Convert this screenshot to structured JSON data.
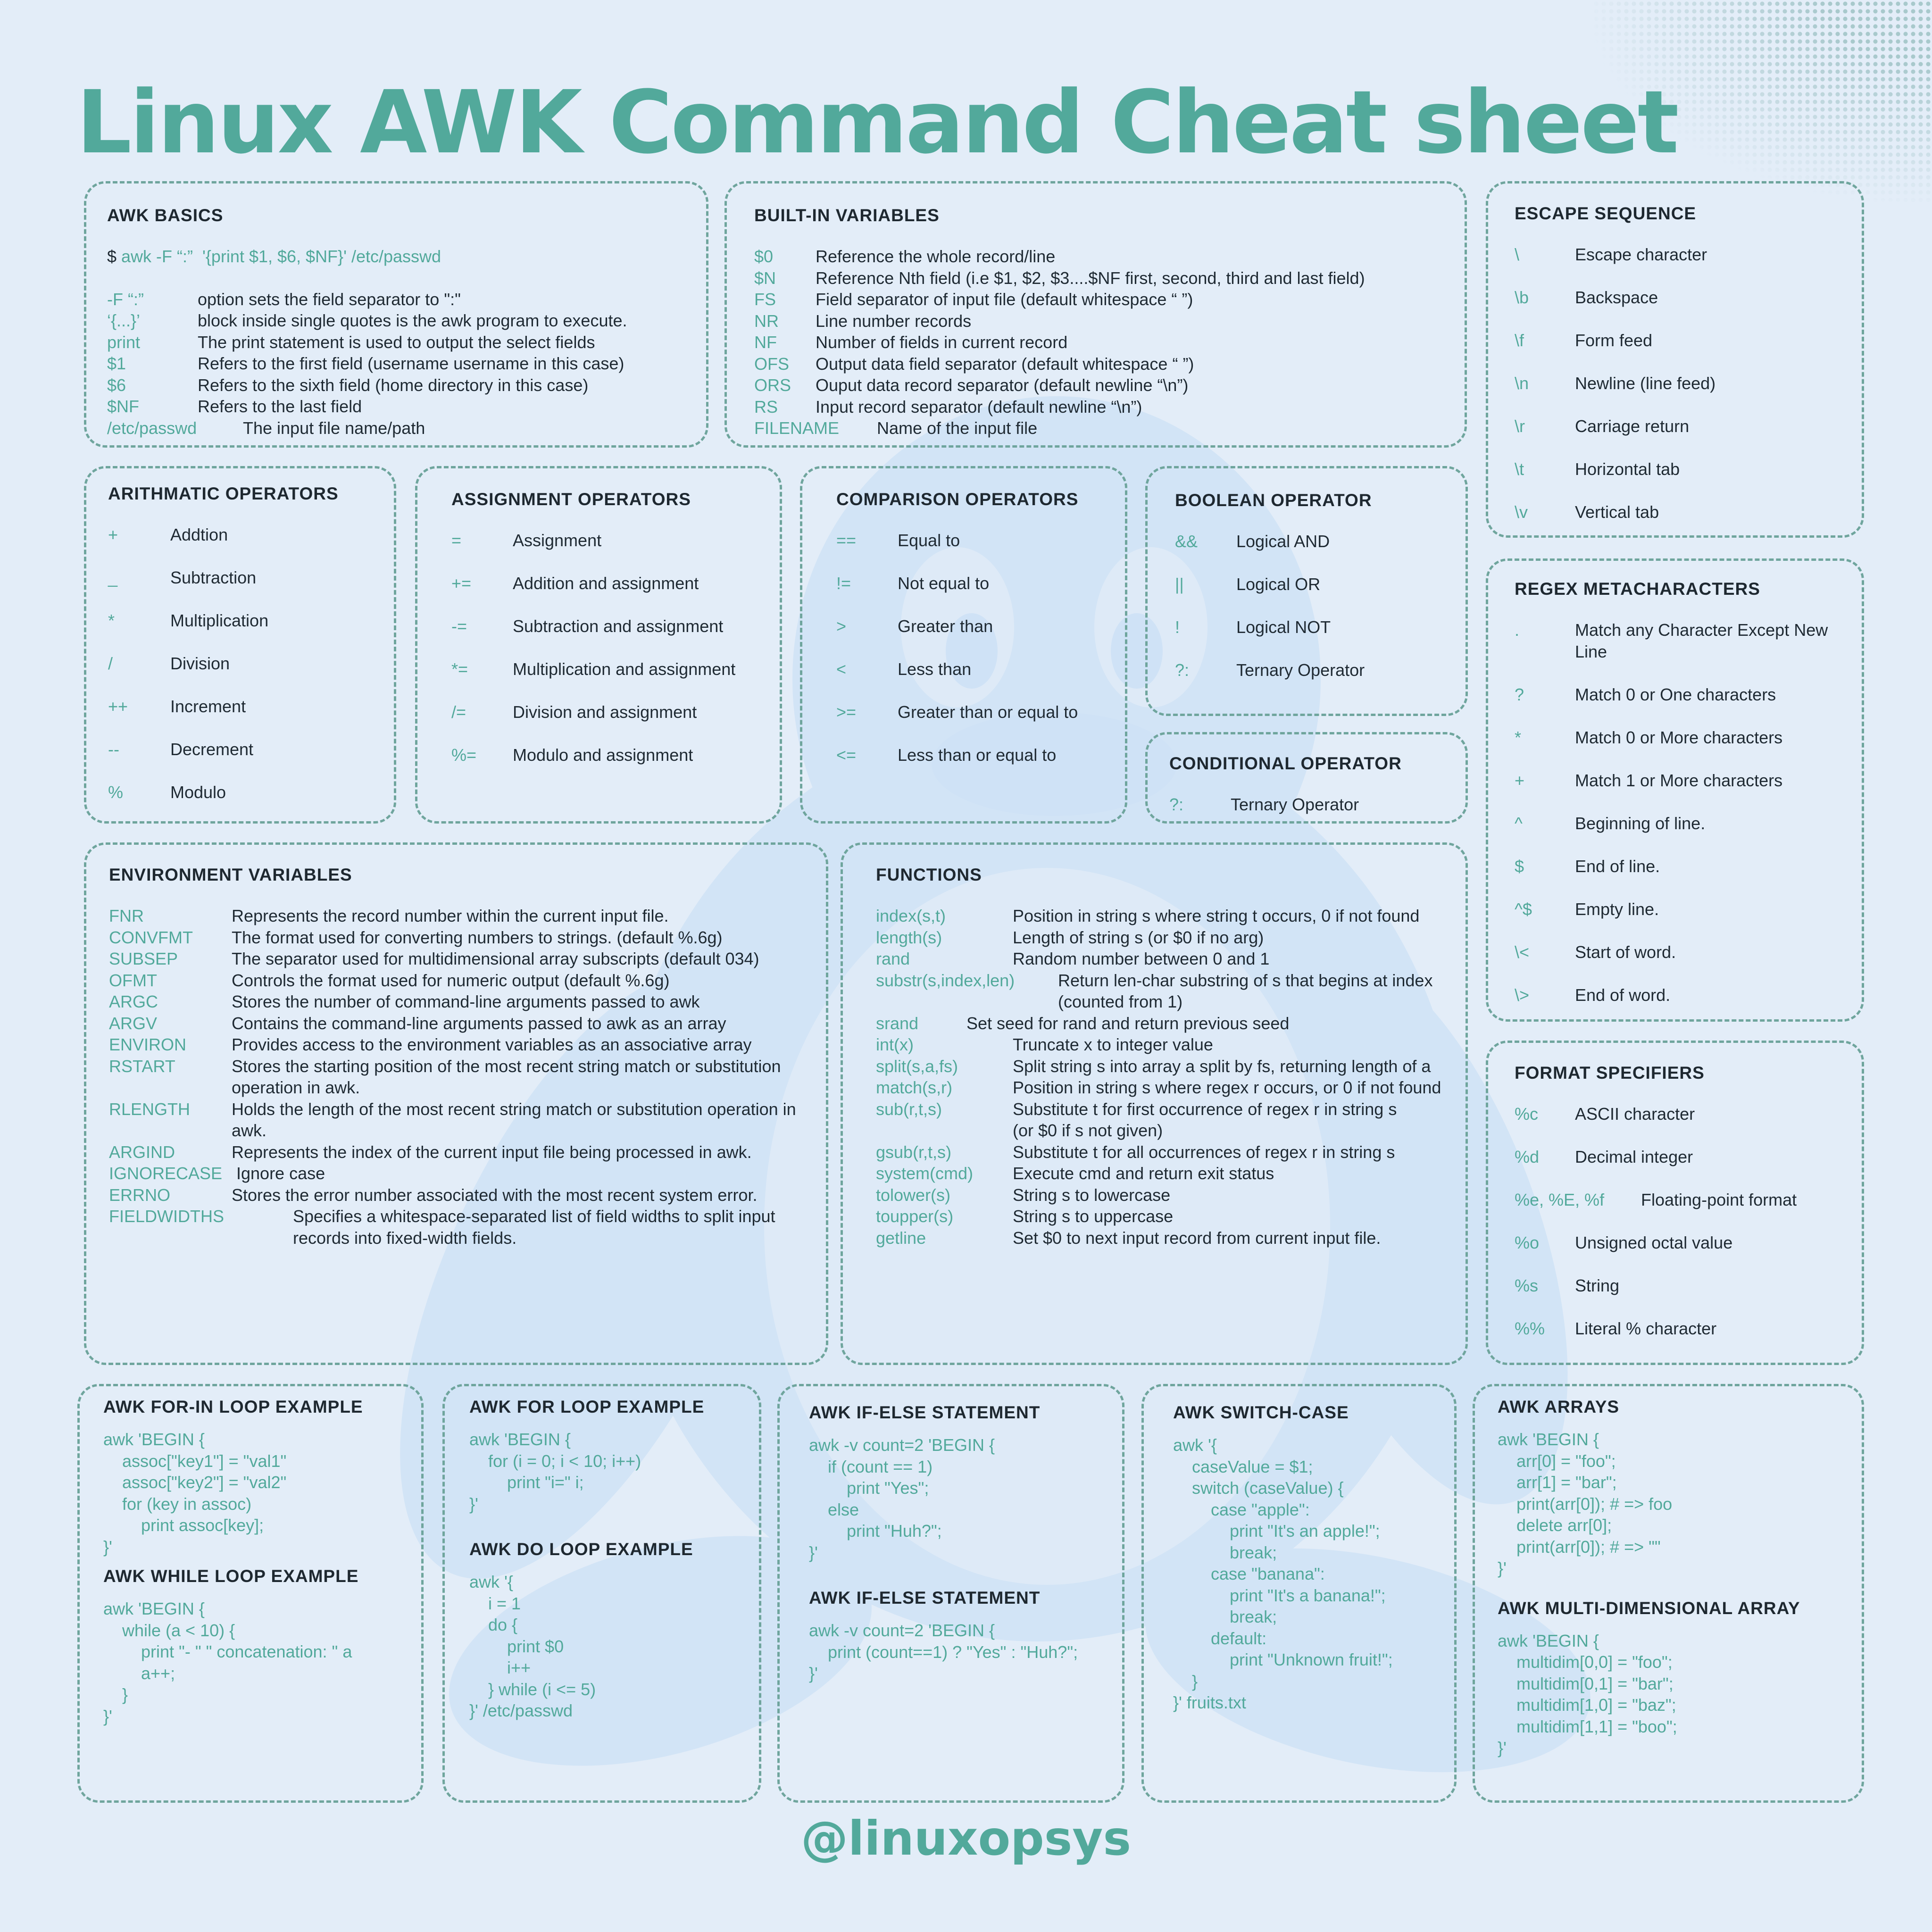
{
  "title": "Linux AWK Command Cheat sheet",
  "handle": "@linuxopsys",
  "colors": {
    "background": "#e3edf8",
    "accent": "#52a99b",
    "border": "#6fa59d",
    "text": "#1e2830",
    "watermark": "#cfe2f6"
  },
  "awk_basics": {
    "heading": "AWK BASICS",
    "prompt": "$",
    "command": " awk -F “:”  '{print $1, $6, $NF}' /etc/passwd",
    "rows": [
      {
        "k": "-F “:”",
        "d": "option sets the field separator to \":\""
      },
      {
        "k": "‘{...}’",
        "d": "block inside single quotes is the awk program to execute."
      },
      {
        "k": "print",
        "d": "The print statement is used to output the select fields"
      },
      {
        "k": "$1",
        "d": "Refers to the first field (username username in this case)"
      },
      {
        "k": "$6",
        "d": "Refers to the sixth field (home directory in this case)"
      },
      {
        "k": "$NF",
        "d": "Refers to the last field"
      },
      {
        "k": "/etc/passwd",
        "d": "The input file name/path"
      }
    ]
  },
  "builtin": {
    "heading": "BUILT-IN VARIABLES",
    "rows": [
      {
        "k": "$0",
        "d": "Reference the whole record/line"
      },
      {
        "k": "$N",
        "d": "Reference Nth field (i.e $1, $2, $3....$NF first, second, third and last field)"
      },
      {
        "k": "FS",
        "d": "Field separator of input file (default whitespace “ ”)"
      },
      {
        "k": "NR",
        "d": "Line number records"
      },
      {
        "k": "NF",
        "d": "Number of fields in current record"
      },
      {
        "k": "OFS",
        "d": "Output data field separator (default whitespace “ ”)"
      },
      {
        "k": "ORS",
        "d": "Ouput data record separator (default newline “\\n”)"
      },
      {
        "k": "RS",
        "d": "Input record separator (default newline “\\n”)"
      },
      {
        "k": "FILENAME",
        "d": "Name of the input file"
      }
    ]
  },
  "escape": {
    "heading": "ESCAPE SEQUENCE",
    "rows": [
      {
        "k": "\\",
        "d": "Escape character"
      },
      {
        "k": "\\b",
        "d": "Backspace"
      },
      {
        "k": "\\f",
        "d": "Form feed"
      },
      {
        "k": "\\n",
        "d": "Newline (line feed)"
      },
      {
        "k": "\\r",
        "d": "Carriage return"
      },
      {
        "k": "\\t",
        "d": "Horizontal tab"
      },
      {
        "k": "\\v",
        "d": "Vertical tab"
      }
    ]
  },
  "arith": {
    "heading": "ARITHMATIC OPERATORS",
    "rows": [
      {
        "k": "+",
        "d": "Addtion"
      },
      {
        "k": "_",
        "d": "Subtraction"
      },
      {
        "k": "*",
        "d": "Multiplication"
      },
      {
        "k": "/",
        "d": "Division"
      },
      {
        "k": "++",
        "d": "Increment"
      },
      {
        "k": "--",
        "d": "Decrement"
      },
      {
        "k": "%",
        "d": "Modulo"
      }
    ]
  },
  "assign": {
    "heading": "ASSIGNMENT OPERATORS",
    "rows": [
      {
        "k": "=",
        "d": "Assignment"
      },
      {
        "k": "+=",
        "d": "Addition and assignment"
      },
      {
        "k": "-=",
        "d": "Subtraction and assignment"
      },
      {
        "k": "*=",
        "d": "Multiplication and assignment"
      },
      {
        "k": "/=",
        "d": "Division and assignment"
      },
      {
        "k": "%=",
        "d": "Modulo and assignment"
      }
    ]
  },
  "compare": {
    "heading": "COMPARISON OPERATORS",
    "rows": [
      {
        "k": "==",
        "d": "Equal to"
      },
      {
        "k": "!=",
        "d": "Not equal to"
      },
      {
        "k": ">",
        "d": "Greater than"
      },
      {
        "k": "<",
        "d": "Less than"
      },
      {
        "k": ">=",
        "d": "Greater than or equal to"
      },
      {
        "k": "<=",
        "d": "Less than or equal to"
      }
    ]
  },
  "boolean": {
    "heading": "BOOLEAN  OPERATOR",
    "rows": [
      {
        "k": "&&",
        "d": "Logical AND"
      },
      {
        "k": "||",
        "d": "Logical OR"
      },
      {
        "k": "!",
        "d": "Logical NOT"
      },
      {
        "k": "?:",
        "d": "Ternary Operator"
      }
    ]
  },
  "conditional": {
    "heading": "CONDITIONAL OPERATOR",
    "rows": [
      {
        "k": "?:",
        "d": "Ternary Operator"
      }
    ]
  },
  "regex": {
    "heading": "REGEX METACHARACTERS",
    "rows": [
      {
        "k": ".",
        "d": "Match any Character Except New Line"
      },
      {
        "k": "?",
        "d": "Match 0 or One characters"
      },
      {
        "k": "*",
        "d": "Match 0 or More characters"
      },
      {
        "k": "+",
        "d": "Match 1 or More characters"
      },
      {
        "k": "^",
        "d": "Beginning of line."
      },
      {
        "k": "$",
        "d": "End of line."
      },
      {
        "k": "^$",
        "d": "Empty line."
      },
      {
        "k": "\\<",
        "d": "Start of word."
      },
      {
        "k": "\\>",
        "d": "End of word."
      }
    ]
  },
  "env": {
    "heading": "ENVIRONMENT VARIABLES",
    "rows": [
      {
        "k": "FNR",
        "d": "Represents the record number within the current input file."
      },
      {
        "k": "CONVFMT",
        "d": "The format used for converting numbers to strings. (default %.6g)"
      },
      {
        "k": "SUBSEP",
        "d": "The separator used for multidimensional array subscripts (default 034)"
      },
      {
        "k": "OFMT",
        "d": "Controls the format used for numeric output (default %.6g)"
      },
      {
        "k": "ARGC",
        "d": "Stores the number of command-line arguments passed to awk"
      },
      {
        "k": "ARGV",
        "d": "Contains the command-line arguments passed to awk as an array"
      },
      {
        "k": "ENVIRON",
        "d": "Provides access to the environment variables as an associative array"
      },
      {
        "k": "RSTART",
        "d": "Stores the starting position of the most recent string match or substitution operation in awk."
      },
      {
        "k": "RLENGTH",
        "d": "Holds the length of the most recent string match or substitution operation in awk."
      },
      {
        "k": "ARGIND",
        "d": "Represents the index of the current input file being processed in awk."
      },
      {
        "k": "IGNORECASE",
        "d": "Ignore case"
      },
      {
        "k": "ERRNO",
        "d": "Stores the error number associated with the most recent system error."
      },
      {
        "k": "FIELDWIDTHS",
        "d": "Specifies a whitespace-separated list of field widths to split input records into fixed-width fields."
      }
    ]
  },
  "functions": {
    "heading": "FUNCTIONS",
    "rows": [
      {
        "k": "index(s,t)",
        "d": "Position in string s where string t occurs, 0 if not found"
      },
      {
        "k": "length(s)",
        "d": "Length of string s (or $0 if no arg)"
      },
      {
        "k": "rand",
        "d": "Random number between 0 and 1"
      },
      {
        "k": "substr(s,index,len)",
        "d": "Return len-char substring of s that begins at index (counted from 1)"
      },
      {
        "k": "srand",
        "d": "Set seed for rand and return previous seed"
      },
      {
        "k": "int(x)",
        "d": "Truncate x to integer value"
      },
      {
        "k": "split(s,a,fs)",
        "d": "Split string s into array a split by fs, returning length of a"
      },
      {
        "k": "match(s,r)",
        "d": "Position in string s where regex r occurs, or 0 if not found"
      },
      {
        "k": "sub(r,t,s)",
        "d": "Substitute t for first occurrence of regex r in string s\n(or $0 if s not given)"
      },
      {
        "k": "gsub(r,t,s)",
        "d": "Substitute t for all occurrences of regex r in string s"
      },
      {
        "k": "system(cmd)",
        "d": "Execute cmd and return exit status"
      },
      {
        "k": "tolower(s)",
        "d": "String s to lowercase"
      },
      {
        "k": "toupper(s)",
        "d": "String s to uppercase"
      },
      {
        "k": "getline",
        "d": "Set $0 to next input record from current input file."
      }
    ]
  },
  "format": {
    "heading": "FORMAT  SPECIFIERS",
    "rows": [
      {
        "k": "%c",
        "d": "ASCII character"
      },
      {
        "k": "%d",
        "d": "Decimal integer"
      },
      {
        "k": "%e, %E, %f",
        "d": "Floating-point format"
      },
      {
        "k": "%o",
        "d": "Unsigned octal value"
      },
      {
        "k": "%s",
        "d": "String"
      },
      {
        "k": "%%",
        "d": "Literal % character"
      }
    ]
  },
  "forin": {
    "heading": "AWK FOR-IN LOOP EXAMPLE",
    "code": "awk 'BEGIN {\n    assoc[\"key1\"] = \"val1\"\n    assoc[\"key2\"] = \"val2\"\n    for (key in assoc)\n        print assoc[key];\n}'"
  },
  "while": {
    "heading": "AWK  WHILE LOOP EXAMPLE",
    "code": "awk 'BEGIN {\n    while (a < 10) {\n        print \"- \" \" concatenation: \" a\n        a++;\n    }\n}'"
  },
  "forloop": {
    "heading": "AWK FOR LOOP EXAMPLE",
    "code": "awk 'BEGIN {\n    for (i = 0; i < 10; i++)\n        print \"i=\" i;\n}'"
  },
  "doloop": {
    "heading": "AWK DO LOOP EXAMPLE",
    "code": "awk '{\n    i = 1\n    do {\n        print $0\n        i++\n    } while (i <= 5)\n}' /etc/passwd"
  },
  "ifelse1": {
    "heading": "AWK IF-ELSE STATEMENT",
    "code": "awk -v count=2 'BEGIN {\n    if (count == 1)\n        print \"Yes\";\n    else\n        print \"Huh?\";\n}'"
  },
  "ifelse2": {
    "heading": "AWK IF-ELSE STATEMENT",
    "code": "awk -v count=2 'BEGIN {\n    print (count==1) ? \"Yes\" : \"Huh?\";\n}'"
  },
  "switchcase": {
    "heading": "AWK SWITCH-CASE",
    "code": "awk '{\n    caseValue = $1;\n    switch (caseValue) {\n        case \"apple\":\n            print \"It's an apple!\";\n            break;\n        case \"banana\":\n            print \"It's a banana!\";\n            break;\n        default:\n            print \"Unknown fruit!\";\n    }\n}' fruits.txt"
  },
  "arrays": {
    "heading": "AWK ARRAYS",
    "code": "awk 'BEGIN {\n    arr[0] = \"foo\";\n    arr[1] = \"bar\";\n    print(arr[0]); # => foo\n    delete arr[0];\n    print(arr[0]); # => \"\"\n}'"
  },
  "multidim": {
    "heading": "AWK  MULTI-DIMENSIONAL ARRAY",
    "code": "awk 'BEGIN {\n    multidim[0,0] = \"foo\";\n    multidim[0,1] = \"bar\";\n    multidim[1,0] = \"baz\";\n    multidim[1,1] = \"boo\";\n}'"
  }
}
